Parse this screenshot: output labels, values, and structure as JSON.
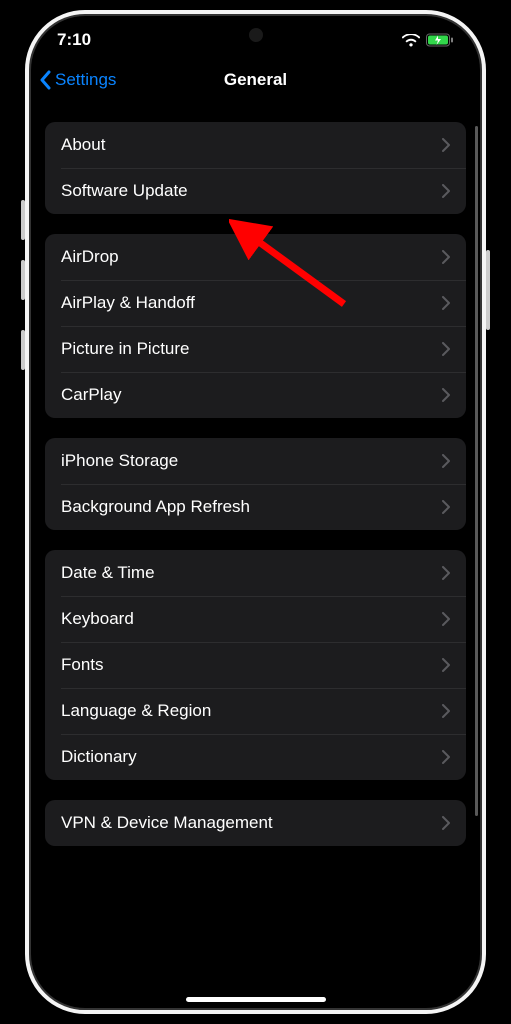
{
  "status": {
    "time": "7:10"
  },
  "nav": {
    "back_label": "Settings",
    "title": "General"
  },
  "groups": [
    {
      "items": [
        {
          "label": "About"
        },
        {
          "label": "Software Update"
        }
      ]
    },
    {
      "items": [
        {
          "label": "AirDrop"
        },
        {
          "label": "AirPlay & Handoff"
        },
        {
          "label": "Picture in Picture"
        },
        {
          "label": "CarPlay"
        }
      ]
    },
    {
      "items": [
        {
          "label": "iPhone Storage"
        },
        {
          "label": "Background App Refresh"
        }
      ]
    },
    {
      "items": [
        {
          "label": "Date & Time"
        },
        {
          "label": "Keyboard"
        },
        {
          "label": "Fonts"
        },
        {
          "label": "Language & Region"
        },
        {
          "label": "Dictionary"
        }
      ]
    },
    {
      "items": [
        {
          "label": "VPN & Device Management"
        }
      ]
    }
  ]
}
